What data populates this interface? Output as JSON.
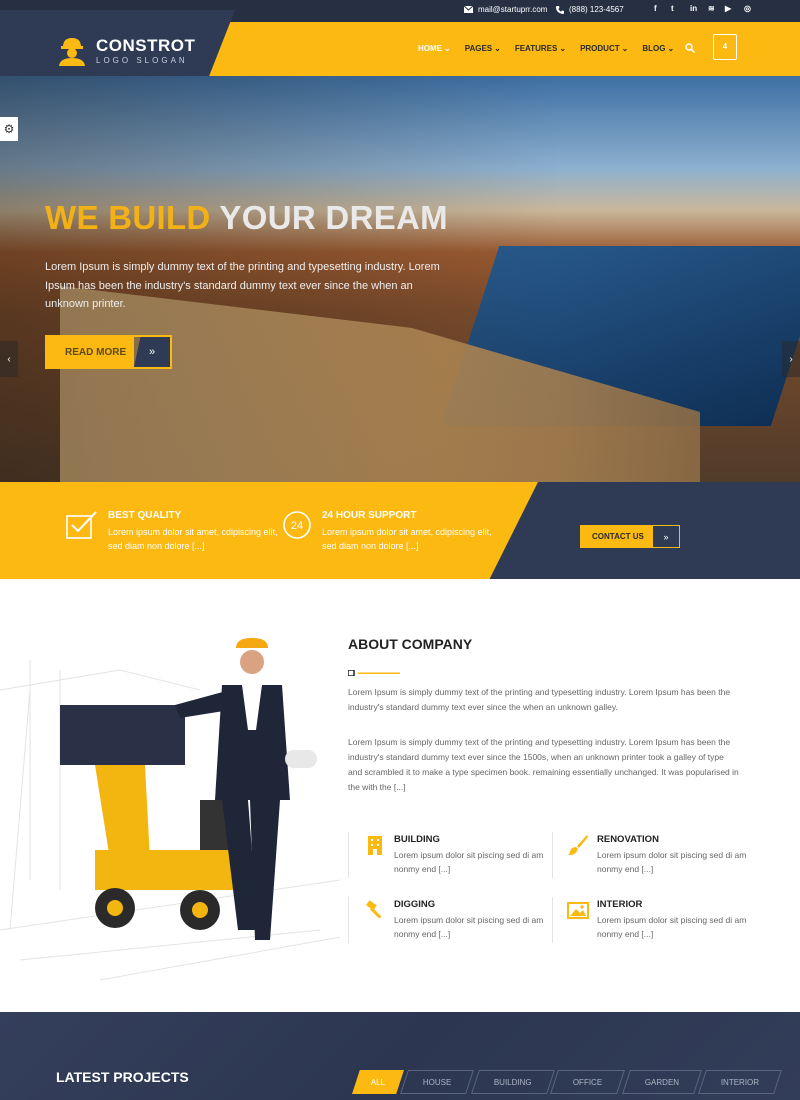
{
  "topbar": {
    "email": "mail@startuprr.com",
    "phone": "(888) 123-4567",
    "social": [
      "f",
      "t",
      "in",
      "rss",
      "yt",
      "ig"
    ]
  },
  "logo": {
    "title": "CONSTROT",
    "slogan": "LOGO SLOGAN"
  },
  "nav": {
    "items": [
      {
        "label": "HOME"
      },
      {
        "label": "PAGES"
      },
      {
        "label": "FEATURES"
      },
      {
        "label": "PRODUCT"
      },
      {
        "label": "BLOG"
      }
    ],
    "cart_count": "4"
  },
  "hero": {
    "title_highlight": "WE BUILD",
    "title_rest": "YOUR DREAM",
    "text": "Lorem Ipsum is simply dummy text of the printing and typesetting industry. Lorem Ipsum has been the industry's standard dummy text ever since the when an unknown printer.",
    "button": "READ MORE"
  },
  "features": {
    "items": [
      {
        "title": "BEST QUALITY",
        "text": "Lorem ipsum dolor sit amet, cdipiscing elit, sed diam non dolore [...]"
      },
      {
        "title": "24 HOUR SUPPORT",
        "text": "Lorem ipsum dolor sit amet, cdipiscing elit, sed diam non dolore [...]"
      }
    ],
    "contact_button": "CONTACT US",
    "support_badge": "24"
  },
  "about": {
    "title": "ABOUT COMPANY",
    "p1": "Lorem Ipsum is simply dummy text of the printing and typesetting industry. Lorem Ipsum has been the industry's standard dummy text ever since the when an unknown galley.",
    "p2": "Lorem Ipsum is simply dummy text of the printing and typesetting industry. Lorem Ipsum has been the industry's standard dummy text ever since the 1500s, when an unknown printer took a galley of type and scrambled it to make a type specimen book. remaining essentially unchanged. It was popularised in the with the [...]",
    "services": [
      {
        "title": "BUILDING",
        "text": "Lorem ipsum dolor sit piscing sed di am nonmy end [...]"
      },
      {
        "title": "RENOVATION",
        "text": "Lorem ipsum dolor sit piscing sed di am nonmy end [...]"
      },
      {
        "title": "DIGGING",
        "text": "Lorem ipsum dolor sit piscing sed di am nonmy end [...]"
      },
      {
        "title": "INTERIOR",
        "text": "Lorem ipsum dolor sit piscing sed di am nonmy end [...]"
      }
    ]
  },
  "projects": {
    "title": "LATEST PROJECTS",
    "filters": [
      "ALL",
      "HOUSE",
      "BUILDING",
      "OFFICE",
      "GARDEN",
      "INTERIOR"
    ]
  },
  "colors": {
    "accent": "#fbb911",
    "navy": "#2f3a55",
    "topbar": "#273043"
  }
}
